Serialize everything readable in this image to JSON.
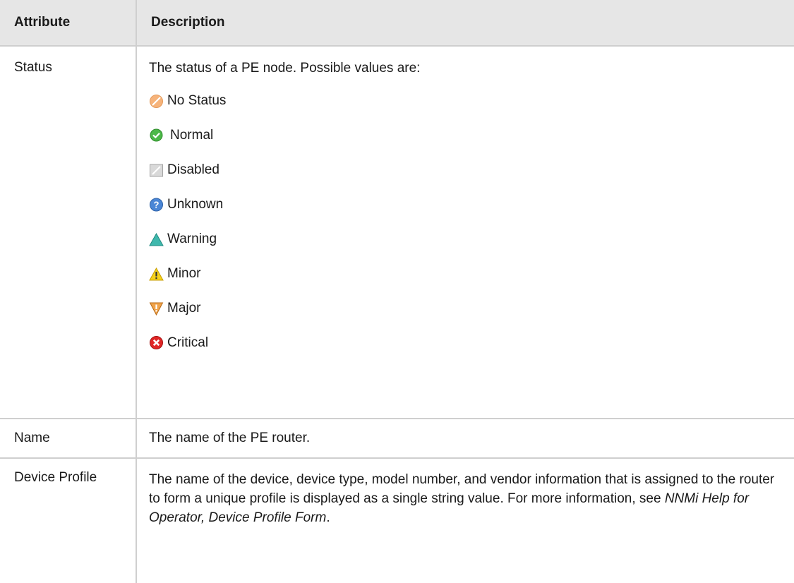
{
  "table": {
    "headers": {
      "attribute": "Attribute",
      "description": "Description"
    },
    "status_row": {
      "attribute": "Status",
      "intro": "The status of a PE node. Possible values are:",
      "values": [
        {
          "label": "No Status",
          "icon": "no-status-icon",
          "color": "#f0a060"
        },
        {
          "label": "Normal",
          "icon": "normal-icon",
          "color": "#4cb848"
        },
        {
          "label": "Disabled",
          "icon": "disabled-icon",
          "color": "#bfbfbf"
        },
        {
          "label": "Unknown",
          "icon": "unknown-icon",
          "color": "#4a86d6"
        },
        {
          "label": "Warning",
          "icon": "warning-icon",
          "color": "#39b2a8"
        },
        {
          "label": "Minor",
          "icon": "minor-icon",
          "color": "#f2c700"
        },
        {
          "label": "Major",
          "icon": "major-icon",
          "color": "#e08a2a"
        },
        {
          "label": "Critical",
          "icon": "critical-icon",
          "color": "#d92020"
        }
      ]
    },
    "name_row": {
      "attribute": "Name",
      "description": "The name of the PE router."
    },
    "device_profile_row": {
      "attribute": "Device Profile",
      "description_main": "The name of the device, device type, model number, and vendor information that is assigned to the router to form a unique profile is displayed as a single string value. For more information, see ",
      "description_ref": "NNMi Help for Operator, Device Profile Form",
      "description_end": "."
    }
  }
}
